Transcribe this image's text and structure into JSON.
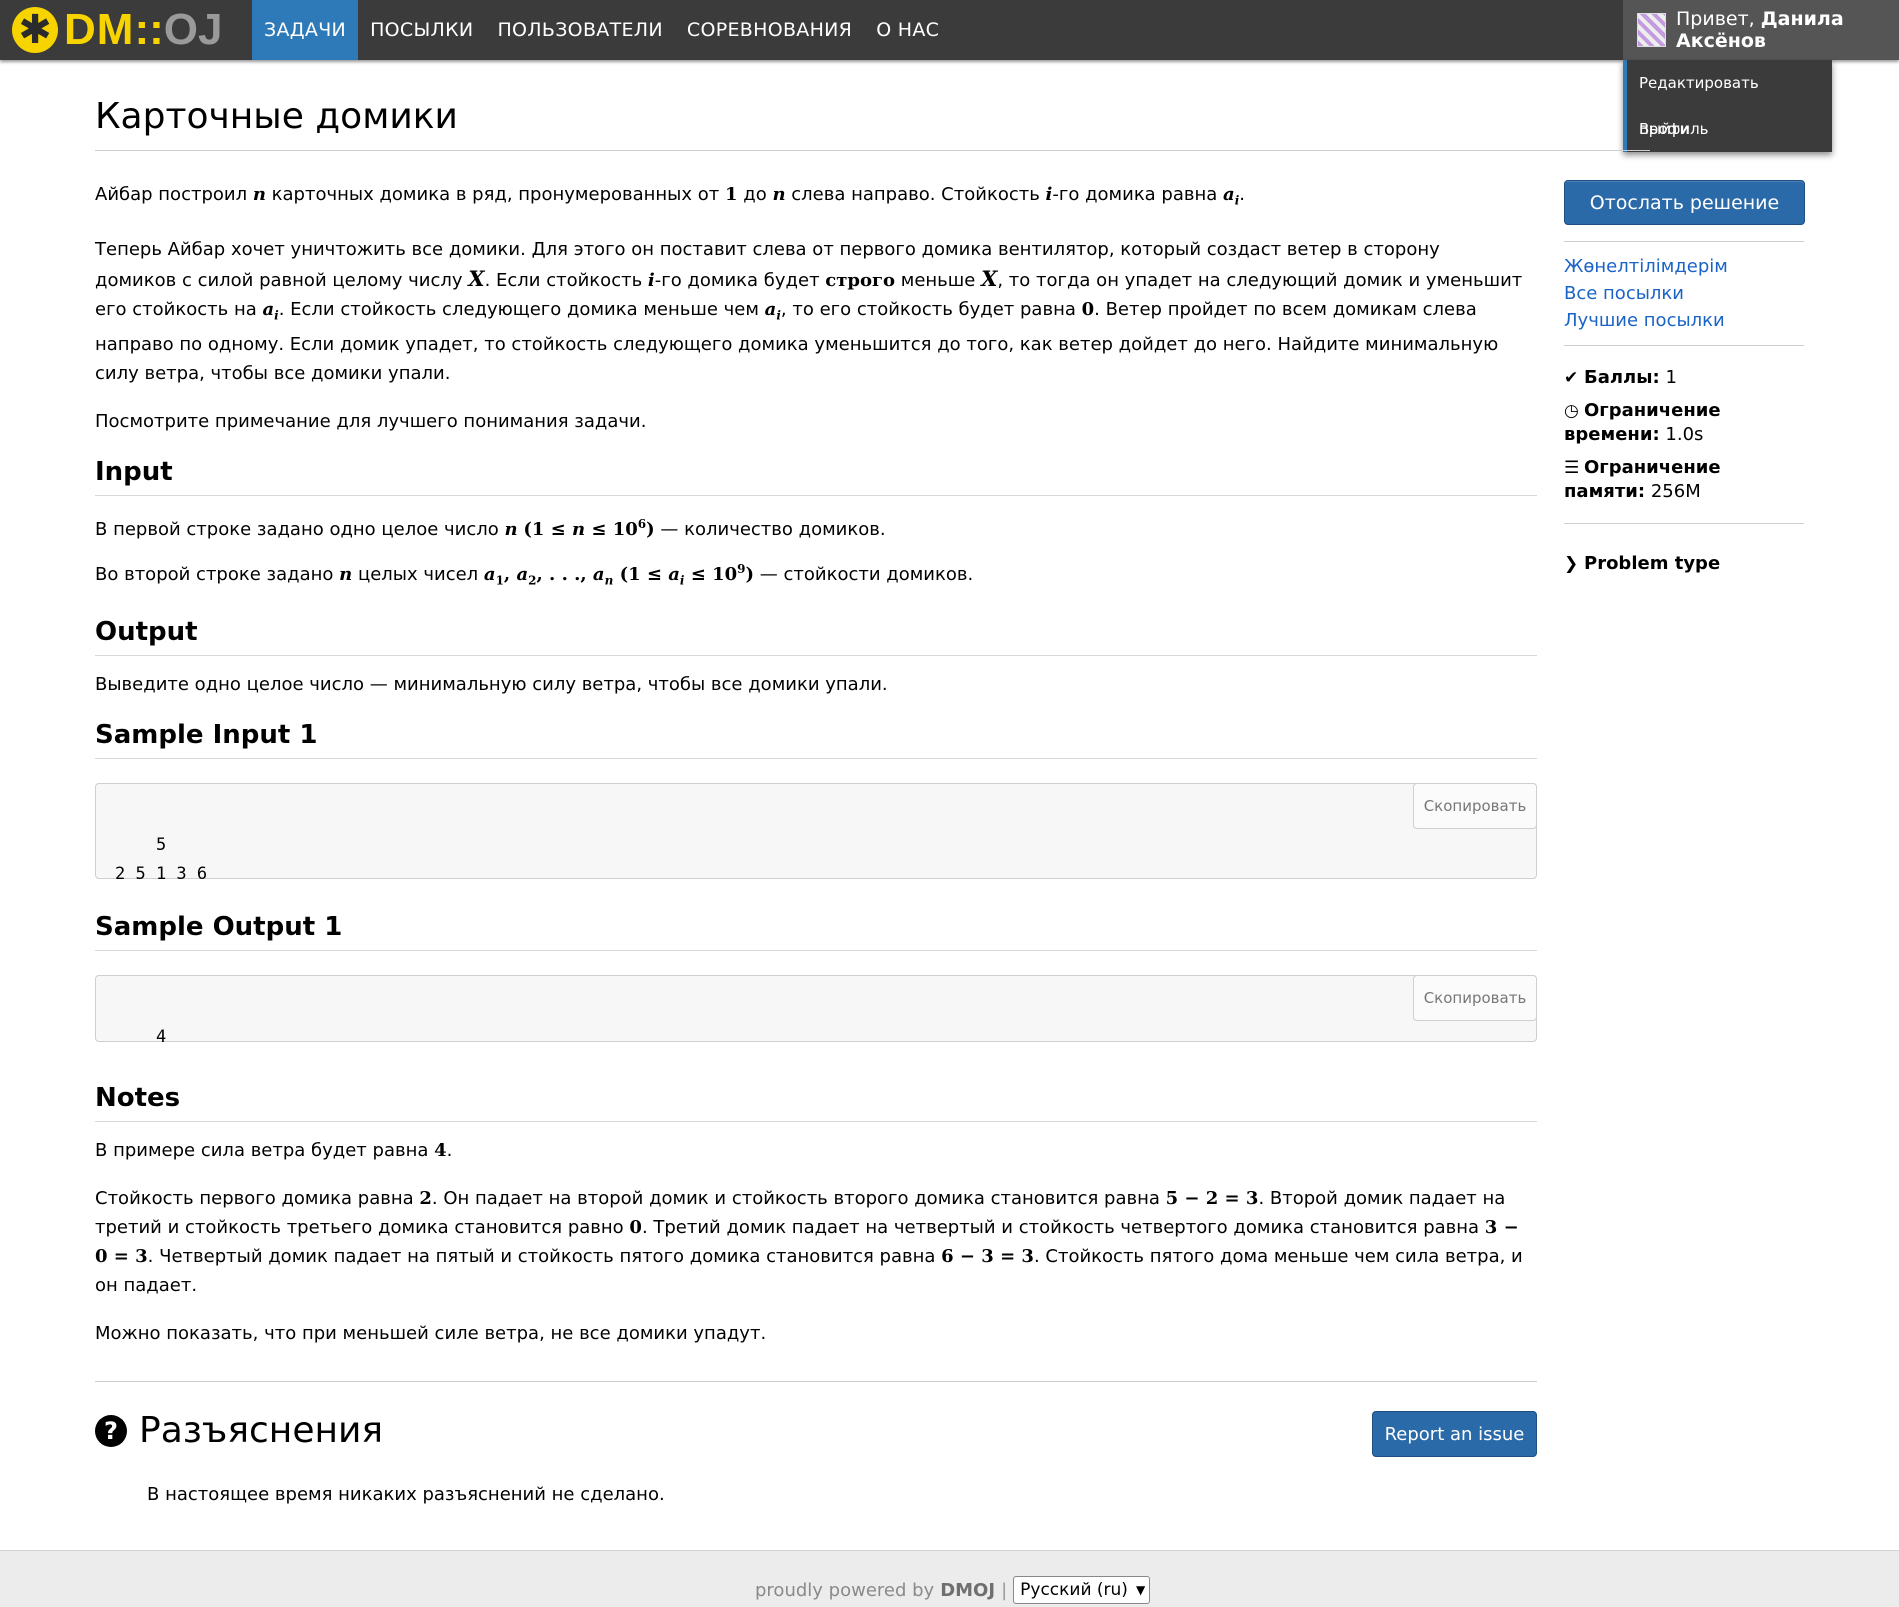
{
  "nav": {
    "logo_dm": "DM",
    "logo_sep": "::",
    "logo_oj": "OJ",
    "items": [
      {
        "label": "ЗАДАЧИ",
        "active": true
      },
      {
        "label": "ПОСЫЛКИ",
        "active": false
      },
      {
        "label": "ПОЛЬЗОВАТЕЛИ",
        "active": false
      },
      {
        "label": "СОРЕВНОВАНИЯ",
        "active": false
      },
      {
        "label": "О НАС",
        "active": false
      }
    ],
    "greeting_prefix": "Привет, ",
    "user_name": "Данила Аксёнов",
    "dropdown": [
      "Редактировать профиль",
      "Выйти"
    ]
  },
  "problem": {
    "title": "Карточные домики",
    "statement": {
      "p1": [
        "Айбар построил ",
        "n",
        " карточных домика в ряд, пронумерованных от ",
        "1",
        " до ",
        "n",
        " слева направо. Стойкость ",
        "i",
        "-го домика равна ",
        "a",
        "i",
        "."
      ],
      "p2_a": "Теперь Айбар хочет уничтожить все домики. Для этого он поставит слева от первого домика вентилятор, который создаст ветер в сторону домиков с силой равной целому числу ",
      "p2_X": "X",
      "p2_b": ". Если стойкость ",
      "p2_i": "i",
      "p2_c": "-го домика будет ",
      "p2_strict": "строго",
      "p2_d": " меньше ",
      "p2_X2": "X",
      "p2_e": ", то тогда он упадет на следующий домик и уменьшит его стойкость на ",
      "p2_ai": "a",
      "p2_ai_sub": "i",
      "p2_f": ". Если стойкость следующего домика меньше чем ",
      "p2_ai2": "a",
      "p2_ai2_sub": "i",
      "p2_g": ", то его стойкость будет равна ",
      "p2_zero": "0",
      "p2_h": ". Ветер пройдет по всем домикам слева направо по одному. Если домик упадет, то стойкость следующего домика уменьшится до того, как ветер дойдет до него. Найдите минимальную силу ветра, чтобы все домики упали.",
      "p3": "Посмотрите примечание для лучшего понимания задачи."
    },
    "input": {
      "heading": "Input",
      "l1_a": "В первой строке задано одно целое число ",
      "l1_n": "n",
      "l1_math": "(1 ≤ ",
      "l1_n2": "n",
      "l1_math2": " ≤ 10",
      "l1_exp": "6",
      "l1_math3": ")",
      "l1_b": " — количество домиков.",
      "l2_a": "Во второй строке задано ",
      "l2_n": "n",
      "l2_b": " целых чисел ",
      "l2_seq": "a",
      "l2_s1": "1",
      "l2_comma1": ", ",
      "l2_seq2": "a",
      "l2_s2": "2",
      "l2_dots": ", . . ., ",
      "l2_seq3": "a",
      "l2_sn": "n",
      "l2_math": " (1 ≤ ",
      "l2_ai": "a",
      "l2_ai_sub": "i",
      "l2_math2": " ≤ 10",
      "l2_exp": "9",
      "l2_math3": ")",
      "l2_c": " — стойкости домиков."
    },
    "output": {
      "heading": "Output",
      "text": "Выведите одно целое число — минимальную силу ветра, чтобы все домики упали."
    },
    "sample_input": {
      "heading": "Sample Input 1",
      "content": "5\n2 5 1 3 6",
      "copy": "Скопировать"
    },
    "sample_output": {
      "heading": "Sample Output 1",
      "content": "4",
      "copy": "Скопировать"
    },
    "notes": {
      "heading": "Notes",
      "p1_a": "В примере сила ветра будет равна ",
      "p1_v": "4",
      "p1_b": ".",
      "p2_a": "Стойкость первого домика равна ",
      "p2_v1": "2",
      "p2_b": ". Он падает на второй домик и стойкость второго домика становится равна ",
      "p2_e1": "5 − 2 = 3",
      "p2_c": ". Второй домик падает на третий и стойкость третьего домика становится равно ",
      "p2_v2": "0",
      "p2_d": ". Третий домик падает на четвертый и стойкость четвертого домика становится равна ",
      "p2_e2": "3 − 0 = 3",
      "p2_e": ". Четвертый домик падает на пятый и стойкость пятого домика становится равна ",
      "p2_e3": "6 − 3 = 3",
      "p2_f": ". Стойкость пятого дома меньше чем сила ветра, и он падает.",
      "p3": "Можно показать, что при меньшей силе ветра, не все домики упадут."
    }
  },
  "sidebar": {
    "submit": "Отослать решение",
    "links": [
      "Жөнелтілімдерім",
      "Все посылки",
      "Лучшие посылки"
    ],
    "points_label": "Баллы:",
    "points_value": "1",
    "time_label": "Ограничение времени:",
    "time_value": "1.0s",
    "memory_label": "Ограничение памяти:",
    "memory_value": "256M",
    "problem_type": "Problem type"
  },
  "clarifications": {
    "title": "Разъяснения",
    "report": "Report an issue",
    "empty": "В настоящее время никаких разъяснений не сделано."
  },
  "footer": {
    "text": "proudly powered by",
    "brand": "DMOJ",
    "sep": "|",
    "language": "Русский (ru)"
  },
  "colors": {
    "navbar": "#3b3b3b",
    "active_nav": "#2e7ab8",
    "logo": "#f7d400",
    "button": "#2a6aa8",
    "link": "#1a63c7"
  }
}
